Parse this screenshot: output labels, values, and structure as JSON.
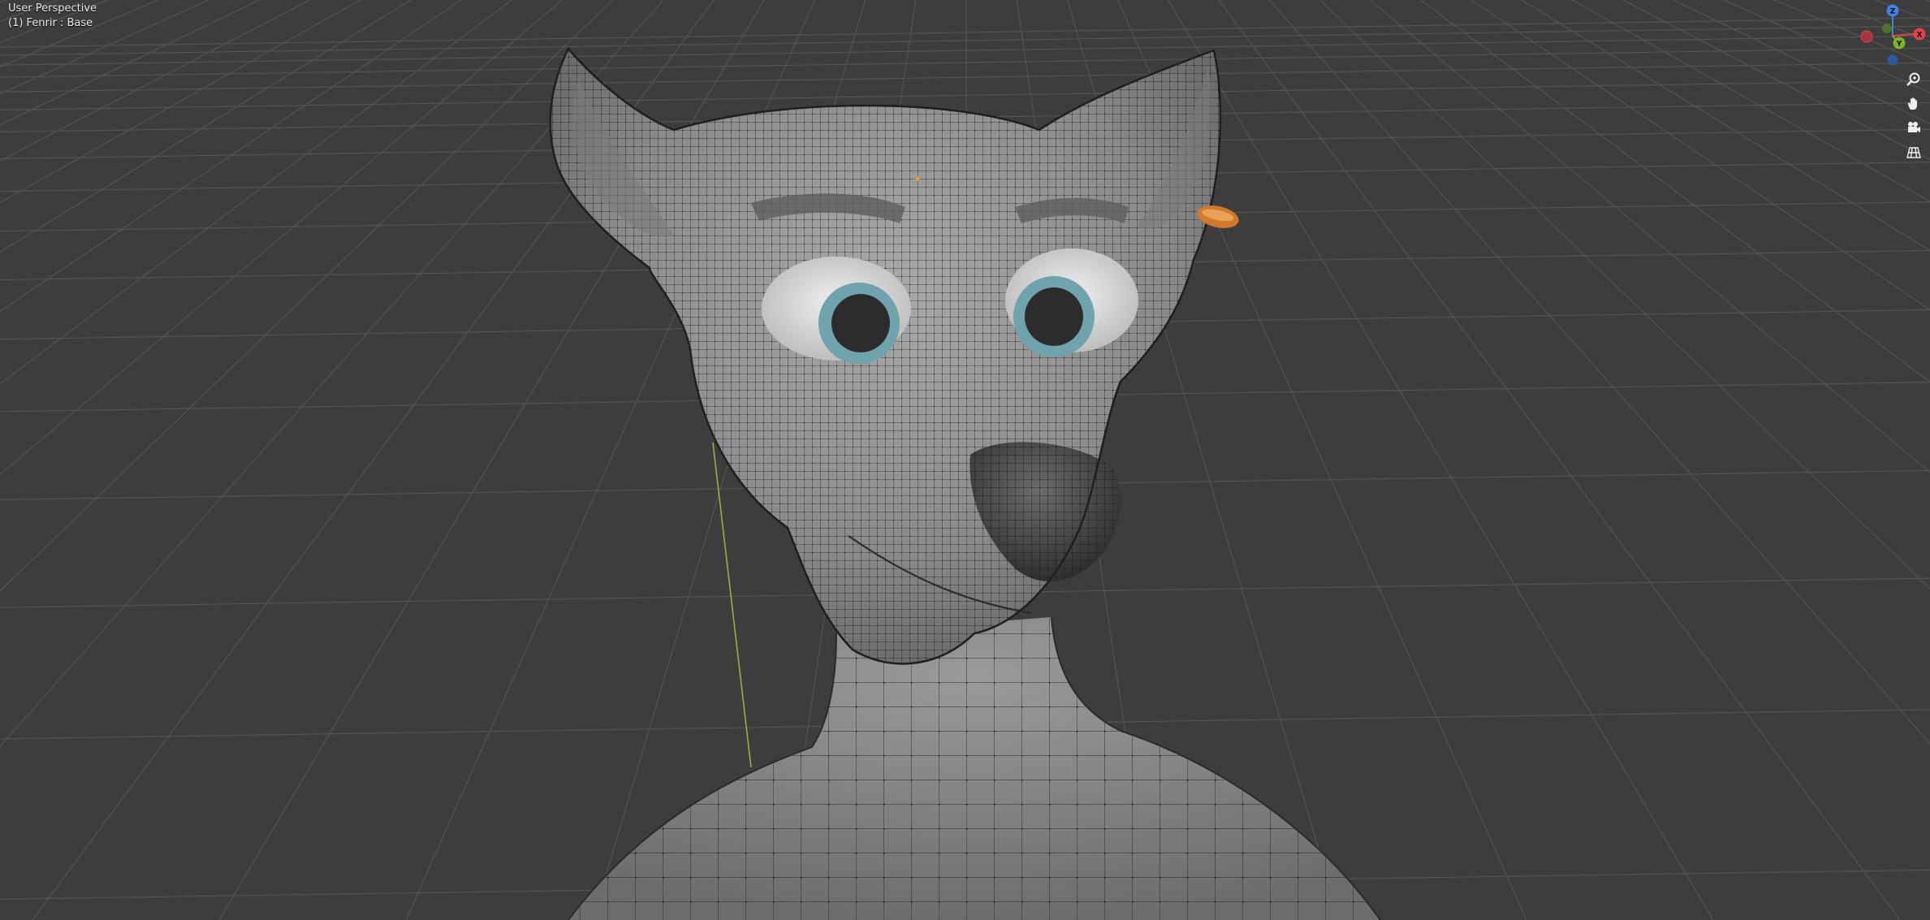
{
  "viewport": {
    "view_name": "User Perspective",
    "object_info": "(1) Fenrir : Base",
    "background_color": "#3d3d3d",
    "grid_color": "#545454"
  },
  "gizmo": {
    "axis_z": "Z",
    "axis_y": "Y",
    "axis_x": "X",
    "colors": {
      "x": "#e2404d",
      "y": "#7cb32a",
      "z": "#3c84e0"
    }
  },
  "nav_buttons": [
    {
      "name": "zoom-icon"
    },
    {
      "name": "pan-hand-icon"
    },
    {
      "name": "camera-view-icon"
    },
    {
      "name": "toggle-projection-icon"
    }
  ],
  "model": {
    "name": "Fenrir",
    "mesh_color": "#8e8e8e",
    "wire_color": "#111111",
    "eye_iris_color": "#6fa3ad",
    "earring_color": "#d27a2c"
  }
}
